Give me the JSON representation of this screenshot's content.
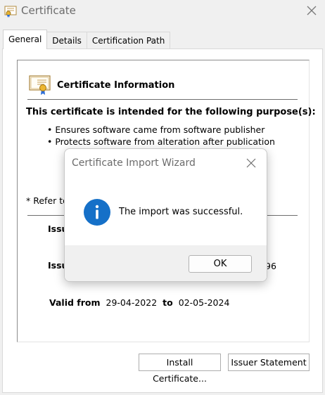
{
  "window": {
    "title": "Certificate",
    "title_icon": "certificate-icon",
    "close_icon": "close-icon"
  },
  "tabs": [
    {
      "label": "General",
      "active": true
    },
    {
      "label": "Details",
      "active": false
    },
    {
      "label": "Certification Path",
      "active": false
    }
  ],
  "general": {
    "heading": "Certificate Information",
    "purpose_heading": "This certificate is intended for the following purpose(s):",
    "purposes": [
      "• Ensures software came from software publisher",
      "• Protects software from alteration after publication"
    ],
    "refer_prefix": "* Refer to",
    "issued_to_label": "Issu",
    "issued_by_label": "Issu",
    "issued_by_tail": "96",
    "valid_from_label": "Valid from",
    "valid_from": "29-04-2022",
    "to_label": "to",
    "valid_to": "02-05-2024",
    "install_button": "Install Certificate...",
    "issuer_button": "Issuer Statement"
  },
  "dialog": {
    "title": "Certificate Import Wizard",
    "message": "The import was successful.",
    "ok_label": "OK",
    "icon": "info-icon"
  },
  "colors": {
    "info_blue": "#0f6cbd",
    "title_gray": "#6b6b6b",
    "footer_gray": "#f0f0f0"
  }
}
